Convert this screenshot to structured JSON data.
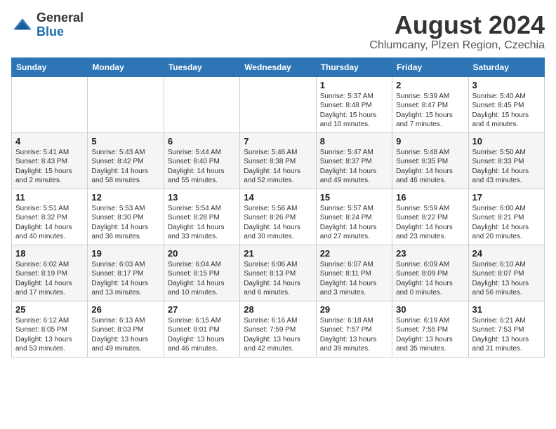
{
  "header": {
    "logo_general": "General",
    "logo_blue": "Blue",
    "month_title": "August 2024",
    "subtitle": "Chlumcany, Plzen Region, Czechia"
  },
  "days_of_week": [
    "Sunday",
    "Monday",
    "Tuesday",
    "Wednesday",
    "Thursday",
    "Friday",
    "Saturday"
  ],
  "weeks": [
    [
      {
        "day": "",
        "sunrise": "",
        "sunset": "",
        "daylight": ""
      },
      {
        "day": "",
        "sunrise": "",
        "sunset": "",
        "daylight": ""
      },
      {
        "day": "",
        "sunrise": "",
        "sunset": "",
        "daylight": ""
      },
      {
        "day": "",
        "sunrise": "",
        "sunset": "",
        "daylight": ""
      },
      {
        "day": "1",
        "sunrise": "Sunrise: 5:37 AM",
        "sunset": "Sunset: 8:48 PM",
        "daylight": "Daylight: 15 hours and 10 minutes."
      },
      {
        "day": "2",
        "sunrise": "Sunrise: 5:39 AM",
        "sunset": "Sunset: 8:47 PM",
        "daylight": "Daylight: 15 hours and 7 minutes."
      },
      {
        "day": "3",
        "sunrise": "Sunrise: 5:40 AM",
        "sunset": "Sunset: 8:45 PM",
        "daylight": "Daylight: 15 hours and 4 minutes."
      }
    ],
    [
      {
        "day": "4",
        "sunrise": "Sunrise: 5:41 AM",
        "sunset": "Sunset: 8:43 PM",
        "daylight": "Daylight: 15 hours and 2 minutes."
      },
      {
        "day": "5",
        "sunrise": "Sunrise: 5:43 AM",
        "sunset": "Sunset: 8:42 PM",
        "daylight": "Daylight: 14 hours and 58 minutes."
      },
      {
        "day": "6",
        "sunrise": "Sunrise: 5:44 AM",
        "sunset": "Sunset: 8:40 PM",
        "daylight": "Daylight: 14 hours and 55 minutes."
      },
      {
        "day": "7",
        "sunrise": "Sunrise: 5:46 AM",
        "sunset": "Sunset: 8:38 PM",
        "daylight": "Daylight: 14 hours and 52 minutes."
      },
      {
        "day": "8",
        "sunrise": "Sunrise: 5:47 AM",
        "sunset": "Sunset: 8:37 PM",
        "daylight": "Daylight: 14 hours and 49 minutes."
      },
      {
        "day": "9",
        "sunrise": "Sunrise: 5:48 AM",
        "sunset": "Sunset: 8:35 PM",
        "daylight": "Daylight: 14 hours and 46 minutes."
      },
      {
        "day": "10",
        "sunrise": "Sunrise: 5:50 AM",
        "sunset": "Sunset: 8:33 PM",
        "daylight": "Daylight: 14 hours and 43 minutes."
      }
    ],
    [
      {
        "day": "11",
        "sunrise": "Sunrise: 5:51 AM",
        "sunset": "Sunset: 8:32 PM",
        "daylight": "Daylight: 14 hours and 40 minutes."
      },
      {
        "day": "12",
        "sunrise": "Sunrise: 5:53 AM",
        "sunset": "Sunset: 8:30 PM",
        "daylight": "Daylight: 14 hours and 36 minutes."
      },
      {
        "day": "13",
        "sunrise": "Sunrise: 5:54 AM",
        "sunset": "Sunset: 8:28 PM",
        "daylight": "Daylight: 14 hours and 33 minutes."
      },
      {
        "day": "14",
        "sunrise": "Sunrise: 5:56 AM",
        "sunset": "Sunset: 8:26 PM",
        "daylight": "Daylight: 14 hours and 30 minutes."
      },
      {
        "day": "15",
        "sunrise": "Sunrise: 5:57 AM",
        "sunset": "Sunset: 8:24 PM",
        "daylight": "Daylight: 14 hours and 27 minutes."
      },
      {
        "day": "16",
        "sunrise": "Sunrise: 5:59 AM",
        "sunset": "Sunset: 8:22 PM",
        "daylight": "Daylight: 14 hours and 23 minutes."
      },
      {
        "day": "17",
        "sunrise": "Sunrise: 6:00 AM",
        "sunset": "Sunset: 8:21 PM",
        "daylight": "Daylight: 14 hours and 20 minutes."
      }
    ],
    [
      {
        "day": "18",
        "sunrise": "Sunrise: 6:02 AM",
        "sunset": "Sunset: 8:19 PM",
        "daylight": "Daylight: 14 hours and 17 minutes."
      },
      {
        "day": "19",
        "sunrise": "Sunrise: 6:03 AM",
        "sunset": "Sunset: 8:17 PM",
        "daylight": "Daylight: 14 hours and 13 minutes."
      },
      {
        "day": "20",
        "sunrise": "Sunrise: 6:04 AM",
        "sunset": "Sunset: 8:15 PM",
        "daylight": "Daylight: 14 hours and 10 minutes."
      },
      {
        "day": "21",
        "sunrise": "Sunrise: 6:06 AM",
        "sunset": "Sunset: 8:13 PM",
        "daylight": "Daylight: 14 hours and 6 minutes."
      },
      {
        "day": "22",
        "sunrise": "Sunrise: 6:07 AM",
        "sunset": "Sunset: 8:11 PM",
        "daylight": "Daylight: 14 hours and 3 minutes."
      },
      {
        "day": "23",
        "sunrise": "Sunrise: 6:09 AM",
        "sunset": "Sunset: 8:09 PM",
        "daylight": "Daylight: 14 hours and 0 minutes."
      },
      {
        "day": "24",
        "sunrise": "Sunrise: 6:10 AM",
        "sunset": "Sunset: 8:07 PM",
        "daylight": "Daylight: 13 hours and 56 minutes."
      }
    ],
    [
      {
        "day": "25",
        "sunrise": "Sunrise: 6:12 AM",
        "sunset": "Sunset: 8:05 PM",
        "daylight": "Daylight: 13 hours and 53 minutes."
      },
      {
        "day": "26",
        "sunrise": "Sunrise: 6:13 AM",
        "sunset": "Sunset: 8:03 PM",
        "daylight": "Daylight: 13 hours and 49 minutes."
      },
      {
        "day": "27",
        "sunrise": "Sunrise: 6:15 AM",
        "sunset": "Sunset: 8:01 PM",
        "daylight": "Daylight: 13 hours and 46 minutes."
      },
      {
        "day": "28",
        "sunrise": "Sunrise: 6:16 AM",
        "sunset": "Sunset: 7:59 PM",
        "daylight": "Daylight: 13 hours and 42 minutes."
      },
      {
        "day": "29",
        "sunrise": "Sunrise: 6:18 AM",
        "sunset": "Sunset: 7:57 PM",
        "daylight": "Daylight: 13 hours and 39 minutes."
      },
      {
        "day": "30",
        "sunrise": "Sunrise: 6:19 AM",
        "sunset": "Sunset: 7:55 PM",
        "daylight": "Daylight: 13 hours and 35 minutes."
      },
      {
        "day": "31",
        "sunrise": "Sunrise: 6:21 AM",
        "sunset": "Sunset: 7:53 PM",
        "daylight": "Daylight: 13 hours and 31 minutes."
      }
    ]
  ]
}
